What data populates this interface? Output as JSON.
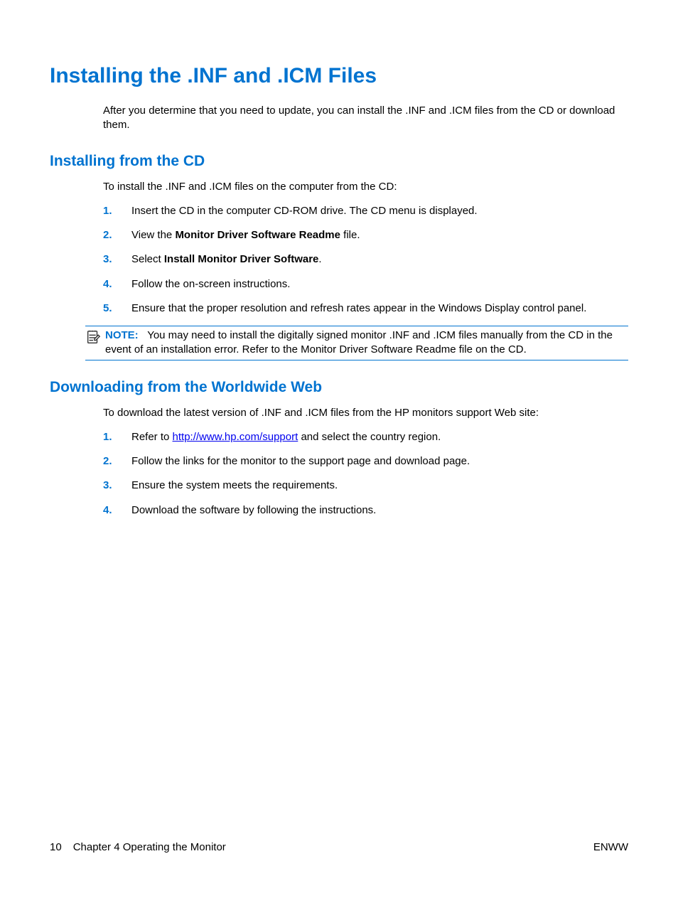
{
  "title": "Installing the .INF and .ICM Files",
  "intro": "After you determine that you need to update, you can install the .INF and .ICM files from the CD or download them.",
  "section1": {
    "heading": "Installing from the CD",
    "lead": "To install the .INF and .ICM files on the computer from the CD:",
    "steps": {
      "s1": "Insert the CD in the computer CD-ROM drive. The CD menu is displayed.",
      "s2a": "View the ",
      "s2b": "Monitor Driver Software Readme",
      "s2c": " file.",
      "s3a": "Select ",
      "s3b": "Install Monitor Driver Software",
      "s3c": ".",
      "s4": "Follow the on-screen instructions.",
      "s5": "Ensure that the proper resolution and refresh rates appear in the Windows Display control panel."
    },
    "note": {
      "label": "NOTE:",
      "text": "You may need to install the digitally signed monitor .INF and .ICM files manually from the CD in the event of an installation error. Refer to the Monitor Driver Software Readme file on the CD."
    }
  },
  "section2": {
    "heading": "Downloading from the Worldwide Web",
    "lead": "To download the latest version of .INF and .ICM files from the HP monitors support Web site:",
    "steps": {
      "s1a": "Refer to ",
      "s1link": "http://www.hp.com/support",
      "s1b": " and select the country region.",
      "s2": "Follow the links for the monitor to the support page and download page.",
      "s3": "Ensure the system meets the requirements.",
      "s4": "Download the software by following the instructions."
    }
  },
  "footer": {
    "page": "10",
    "chapter": "Chapter 4   Operating the Monitor",
    "right": "ENWW"
  }
}
